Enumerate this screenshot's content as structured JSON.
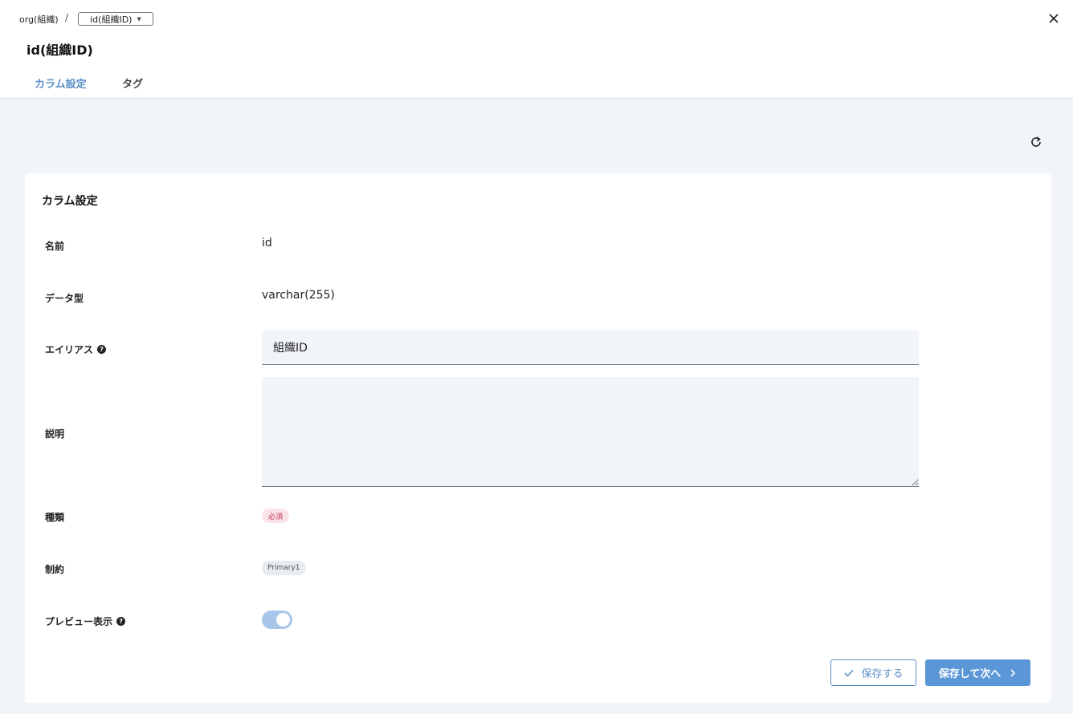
{
  "breadcrumb": {
    "root": "org(組織)",
    "separator": "/",
    "current": "id(組織ID)"
  },
  "header": {
    "title": "id(組織ID)"
  },
  "tabs": [
    {
      "label": "カラム設定",
      "active": true
    },
    {
      "label": "タグ",
      "active": false
    }
  ],
  "card": {
    "title": "カラム設定"
  },
  "fields": {
    "name": {
      "label": "名前",
      "value": "id"
    },
    "data_type": {
      "label": "データ型",
      "value": "varchar(255)"
    },
    "alias": {
      "label": "エイリアス",
      "value": "組織ID"
    },
    "description": {
      "label": "説明",
      "value": ""
    },
    "kind": {
      "label": "種類",
      "badge": "必須"
    },
    "constraint": {
      "label": "制約",
      "badge": "Primary1"
    },
    "preview": {
      "label": "プレビュー表示",
      "enabled": true
    }
  },
  "buttons": {
    "save": "保存する",
    "save_next": "保存して次へ"
  },
  "colors": {
    "accent": "#5b96d6",
    "canvas": "#f1f4f8",
    "required_badge": "#fbe3ea"
  }
}
